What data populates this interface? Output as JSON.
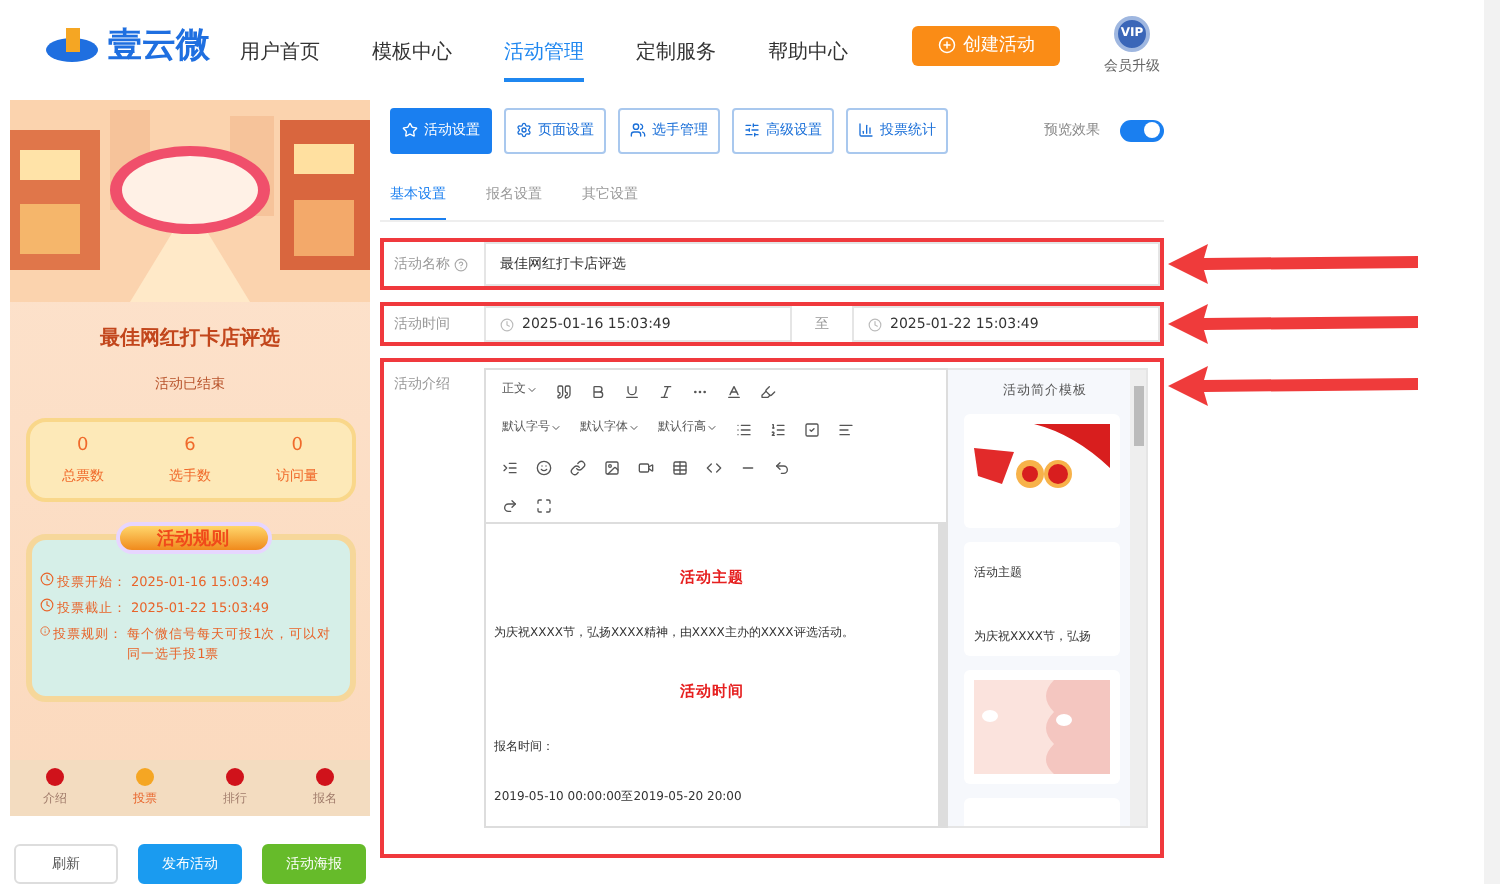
{
  "header": {
    "logo": "壹云微",
    "nav": [
      {
        "label": "用户首页",
        "selected": false
      },
      {
        "label": "模板中心",
        "selected": false
      },
      {
        "label": "活动管理",
        "selected": true
      },
      {
        "label": "定制服务",
        "selected": false
      },
      {
        "label": "帮助中心",
        "selected": false
      }
    ],
    "create_button": "创建活动",
    "vip_badge": "VIP",
    "vip_label": "会员升级"
  },
  "preview": {
    "title": "最佳网红打卡店评选",
    "status": "活动已结束",
    "stats": [
      {
        "value": "0",
        "label": "总票数"
      },
      {
        "value": "6",
        "label": "选手数"
      },
      {
        "value": "0",
        "label": "访问量"
      }
    ],
    "rules_title": "活动规则",
    "rules": [
      {
        "kind": "clock",
        "label": "投票开始：",
        "value": "2025-01-16 15:03:49"
      },
      {
        "kind": "clock",
        "label": "投票截止：",
        "value": "2025-01-22 15:03:49"
      },
      {
        "kind": "info",
        "label": "投票规则：",
        "value": "每个微信号每天可投1次，可以对同一选手投1票"
      }
    ],
    "bottom_nav": [
      {
        "label": "介绍",
        "selected": false
      },
      {
        "label": "投票",
        "selected": true
      },
      {
        "label": "排行",
        "selected": false
      },
      {
        "label": "报名",
        "selected": false
      }
    ]
  },
  "preview_buttons": [
    {
      "label": "刷新",
      "kind": "plain"
    },
    {
      "label": "发布活动",
      "kind": "primary"
    },
    {
      "label": "活动海报",
      "kind": "success"
    }
  ],
  "tool_buttons": [
    {
      "label": "活动设置",
      "selected": true
    },
    {
      "label": "页面设置",
      "selected": false
    },
    {
      "label": "选手管理",
      "selected": false
    },
    {
      "label": "高级设置",
      "selected": false
    },
    {
      "label": "投票统计",
      "selected": false
    }
  ],
  "preview_toggle": {
    "label": "预览效果",
    "on": true
  },
  "tabs": [
    {
      "label": "基本设置",
      "selected": true
    },
    {
      "label": "报名设置",
      "selected": false
    },
    {
      "label": "其它设置",
      "selected": false
    }
  ],
  "form": {
    "name_row": {
      "label": "活动名称",
      "value": "最佳网红打卡店评选",
      "highlighted": true,
      "arrow": true
    },
    "time_row": {
      "label": "活动时间",
      "start": "2025-01-16 15:03:49",
      "separator": "至",
      "end": "2025-01-22 15:03:49",
      "highlighted": true,
      "arrow": true
    },
    "intro_row": {
      "label": "活动介绍",
      "highlighted": true,
      "arrow": true,
      "selects": [
        "正文",
        "默认字号",
        "默认字体",
        "默认行高"
      ],
      "content": [
        {
          "kind": "heading",
          "text": "活动主题"
        },
        {
          "kind": "paragraph",
          "text": "为庆祝XXXX节，弘扬XXXX精神，由XXXX主办的XXXX评选活动。"
        },
        {
          "kind": "heading",
          "text": "活动时间"
        },
        {
          "kind": "paragraph",
          "text": "报名时间："
        },
        {
          "kind": "paragraph",
          "text": "2019-05-10 00:00:00至2019-05-20 20:00"
        }
      ],
      "templates_title": "活动简介模板",
      "templates": [
        {
          "kind": "picture"
        },
        {
          "kind": "text",
          "title": "活动主题",
          "text": "为庆祝XXXX节，弘扬"
        },
        {
          "kind": "picture"
        },
        {
          "kind": "empty"
        }
      ]
    }
  }
}
